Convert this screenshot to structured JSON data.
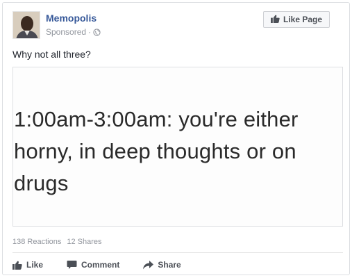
{
  "post": {
    "page_name": "Memopolis",
    "sponsored_label": "Sponsored",
    "separator": "·",
    "like_page_label": "Like Page",
    "text": "Why not all three?",
    "meme_text": "1:00am-3:00am: you're either\nhorny, in deep thoughts or on\ndrugs"
  },
  "stats": {
    "reactions": "138 Reactions",
    "shares": "12 Shares"
  },
  "actions": {
    "like": "Like",
    "comment": "Comment",
    "share": "Share"
  },
  "colors": {
    "link_blue": "#365899",
    "meta_gray": "#90949c",
    "action_gray": "#4b4f56"
  }
}
